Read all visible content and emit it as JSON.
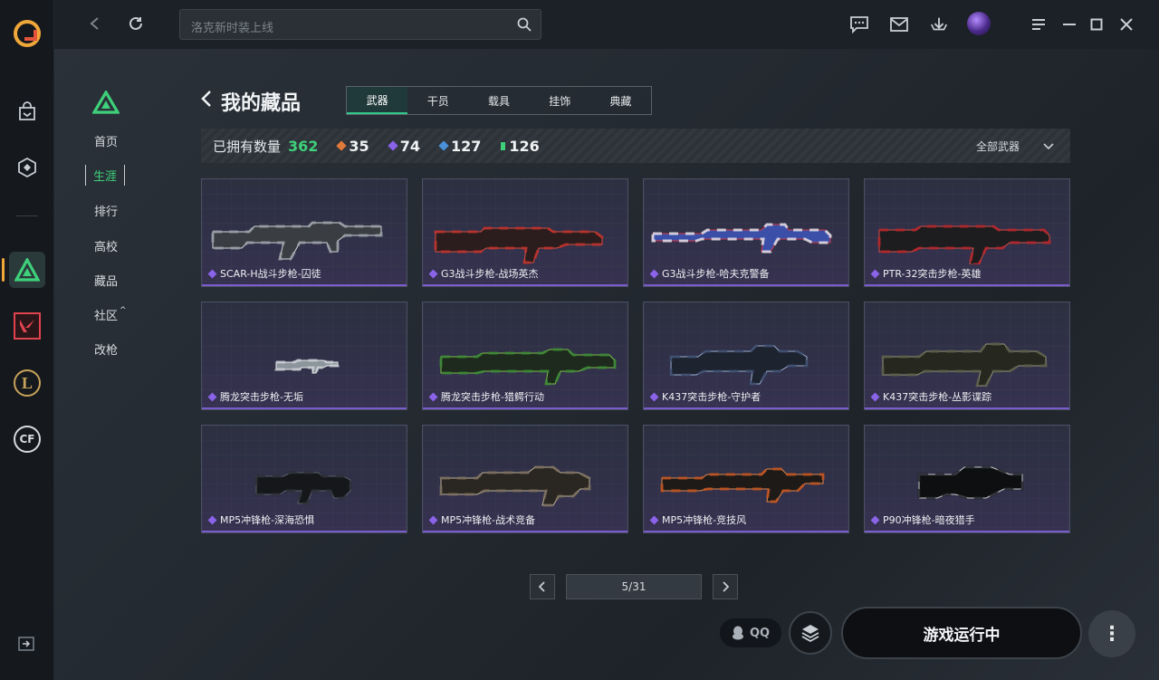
{
  "app": {
    "search_placeholder": "洛克新时装上线",
    "accent_green": "#3ed07a",
    "accent_orange": "#f0a73a",
    "rarity_purple": "#8a63e8"
  },
  "sidebar": {
    "items": [
      {
        "label": "首页",
        "active": false
      },
      {
        "label": "生涯",
        "active": true
      },
      {
        "label": "排行",
        "active": false
      },
      {
        "label": "高校",
        "active": false
      },
      {
        "label": "藏品",
        "active": false
      },
      {
        "label": "社区",
        "active": false
      },
      {
        "label": "改枪",
        "active": false
      }
    ],
    "community_chevron": "^"
  },
  "header": {
    "title": "我的藏品",
    "tabs": [
      {
        "label": "武器",
        "active": true
      },
      {
        "label": "干员",
        "active": false
      },
      {
        "label": "载具",
        "active": false
      },
      {
        "label": "挂饰",
        "active": false
      },
      {
        "label": "典藏",
        "active": false
      }
    ]
  },
  "stats": {
    "owned_label": "已拥有数量",
    "owned_total": "362",
    "tiers": [
      {
        "value": "35",
        "color": "#e07a3a"
      },
      {
        "value": "74",
        "color": "#8a63e8"
      },
      {
        "value": "127",
        "color": "#4a90d9"
      },
      {
        "value": "126",
        "color": "#3ed07a"
      }
    ],
    "filter_label": "全部武器"
  },
  "items": [
    {
      "name": "SCAR-H战斗步枪-囚徒",
      "palette": [
        "#3a3d42",
        "#9aa0a6",
        "#d8dadc"
      ]
    },
    {
      "name": "G3战斗步枪-战场英杰",
      "palette": [
        "#2b1d1d",
        "#c0322c",
        "#e24b3c"
      ]
    },
    {
      "name": "G3战斗步枪-哈夫克警备",
      "palette": [
        "#3b4fa8",
        "#e8ecf4",
        "#d23c4a"
      ]
    },
    {
      "name": "PTR-32突击步枪-英雄",
      "palette": [
        "#1d1d20",
        "#b8262b",
        "#e04a44"
      ]
    },
    {
      "name": "腾龙突击步枪-无垢",
      "palette": [
        "#8c949c",
        "#c8cdd2",
        "#eef0f2"
      ]
    },
    {
      "name": "腾龙突击步枪-猎鳄行动",
      "palette": [
        "#1d2a1d",
        "#3b8a34",
        "#7bc24a"
      ]
    },
    {
      "name": "K437突击步枪-守护者",
      "palette": [
        "#1e2330",
        "#3a4a6a",
        "#9ab0d0"
      ]
    },
    {
      "name": "K437突击步枪-丛影谍踪",
      "palette": [
        "#262820",
        "#5a5c48",
        "#9a9878"
      ]
    },
    {
      "name": "MP5冲锋枪-深海恐惧",
      "palette": [
        "#15171a",
        "#2a2e34",
        "#5a6068"
      ]
    },
    {
      "name": "MP5冲锋枪-战术竞备",
      "palette": [
        "#2a2622",
        "#7a6e5c",
        "#c0b49a"
      ]
    },
    {
      "name": "MP5冲锋枪-竞技风",
      "palette": [
        "#1d1a18",
        "#c4541e",
        "#e9874a"
      ]
    },
    {
      "name": "P90冲锋枪-暗夜猎手",
      "palette": [
        "#0e0f11",
        "#222428",
        "#c8cacc"
      ]
    }
  ],
  "pagination": {
    "current": "5/31",
    "prev": "<",
    "next": ">"
  },
  "bottom": {
    "qq_label": "QQ",
    "launch_label": "游戏运行中",
    "more_label": "⋮"
  }
}
